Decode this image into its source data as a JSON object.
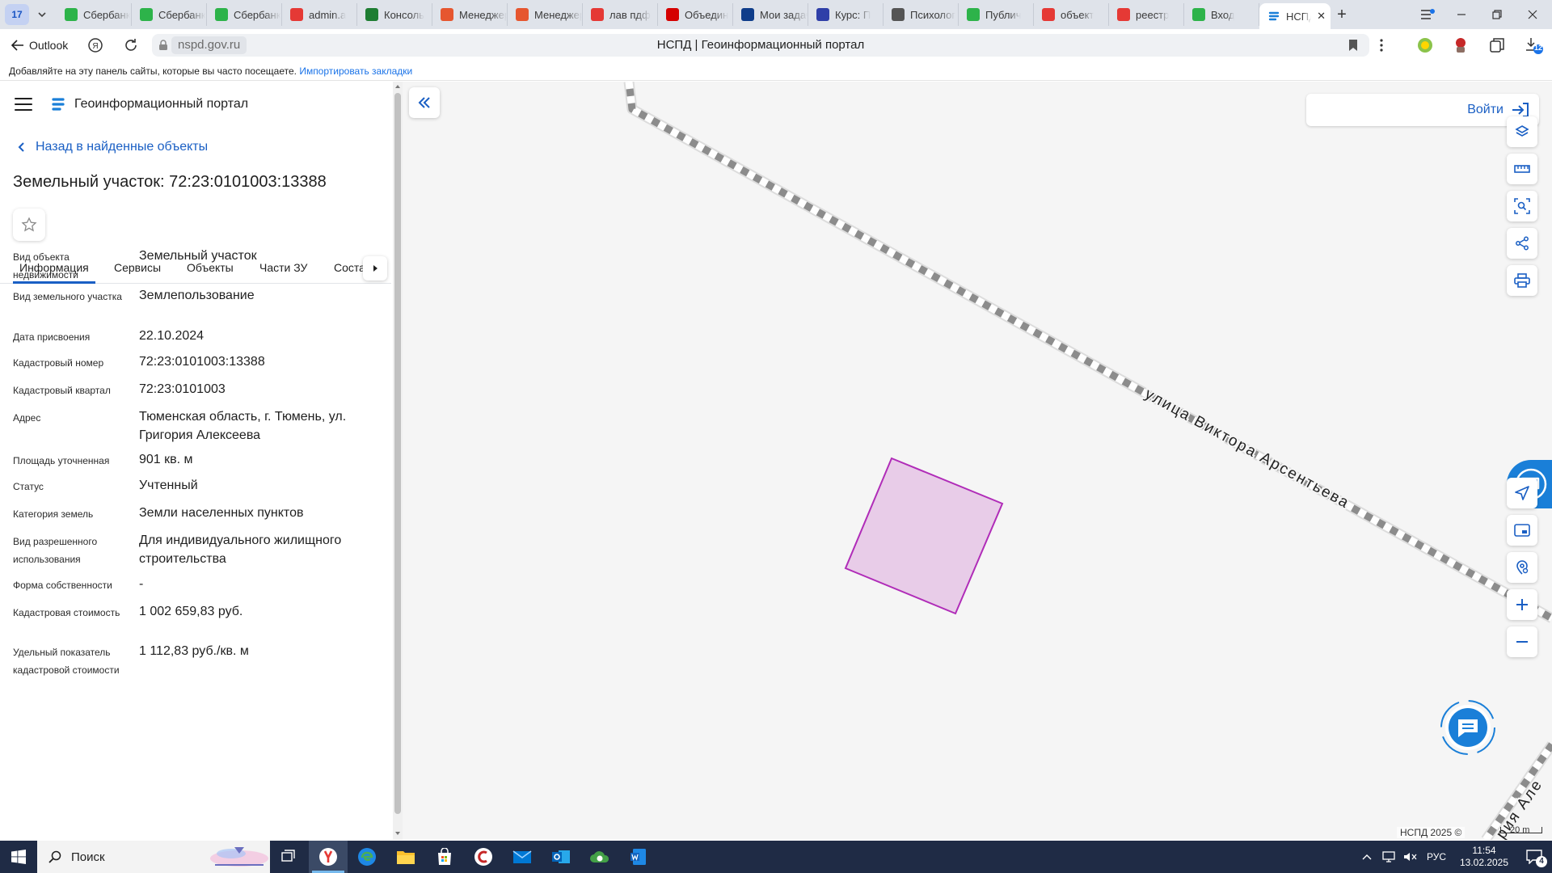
{
  "browser": {
    "tab_count": "17",
    "tabs": [
      {
        "title": "Сбербанк",
        "icon": "check-circle-icon",
        "color": "#2db34a"
      },
      {
        "title": "Сбербанк",
        "icon": "check-circle-icon",
        "color": "#2db34a"
      },
      {
        "title": "Сбербанк",
        "icon": "check-circle-icon",
        "color": "#2db34a"
      },
      {
        "title": "admin.a",
        "icon": "yandex-icon",
        "color": "#e53935"
      },
      {
        "title": "Консоль",
        "icon": "flag-icon",
        "color": "#1e7d32"
      },
      {
        "title": "Менеджер",
        "icon": "joomla-icon",
        "color": "#e6562f"
      },
      {
        "title": "Менеджер",
        "icon": "joomla-icon",
        "color": "#e6562f"
      },
      {
        "title": "лав пдф",
        "icon": "yandex-icon",
        "color": "#e53935"
      },
      {
        "title": "Объедин",
        "icon": "gift-icon",
        "color": "#d50000"
      },
      {
        "title": "Мои задачи",
        "icon": "24-icon",
        "color": "#0f3d8a"
      },
      {
        "title": "Курс: П",
        "icon": "bookmark-icon",
        "color": "#2f3fa8"
      },
      {
        "title": "Психолог",
        "icon": "page-icon",
        "color": "#555555"
      },
      {
        "title": "Публич",
        "icon": "check-circle-icon",
        "color": "#2db34a"
      },
      {
        "title": "объект",
        "icon": "yandex-icon",
        "color": "#e53935"
      },
      {
        "title": "реестр",
        "icon": "yandex-icon",
        "color": "#e53935"
      },
      {
        "title": "Вход",
        "icon": "plus-green-icon",
        "color": "#2db34a"
      }
    ],
    "active_tab": {
      "title": "НСПД",
      "icon": "nspd-icon"
    },
    "back_label": "Outlook",
    "url": "nspd.gov.ru",
    "page_title": "НСПД | Геоинформационный портал",
    "downloads_badge": "12",
    "bookmarks_hint": "Добавляйте на эту панель сайты, которые вы часто посещаете.",
    "bookmarks_link": "Импортировать закладки"
  },
  "panel": {
    "app_title": "Геоинформационный портал",
    "back_link": "Назад в найденные объекты",
    "object_title": "Земельный участок: 72:23:0101003:13388",
    "tabs": [
      "Информация",
      "Сервисы",
      "Объекты",
      "Части ЗУ",
      "Состав"
    ],
    "fields": [
      {
        "label": "Вид объекта недвижимости",
        "value": "Земельный участок"
      },
      {
        "label": "Вид земельного участка",
        "value": "Землепользование"
      },
      {
        "label": "Дата присвоения",
        "value": "22.10.2024"
      },
      {
        "label": "Кадастровый номер",
        "value": "72:23:0101003:13388"
      },
      {
        "label": "Кадастровый квартал",
        "value": "72:23:0101003"
      },
      {
        "label": "Адрес",
        "value": "Тюменская область, г. Тюмень, ул. Григория Алексеева"
      },
      {
        "label": "Площадь уточненная",
        "value": "901 кв. м"
      },
      {
        "label": "Статус",
        "value": "Учтенный"
      },
      {
        "label": "Категория земель",
        "value": "Земли населенных пунктов"
      },
      {
        "label": "Вид разрешенного использования",
        "value": "Для индивидуального жилищного строительства"
      },
      {
        "label": "Форма собственности",
        "value": "-"
      },
      {
        "label": "Кадастровая стоимость",
        "value": "1 002 659,83 руб."
      },
      {
        "label": "Удельный показатель кадастровой стоимости",
        "value": "1 112,83 руб./кв. м"
      }
    ]
  },
  "map": {
    "login_label": "Войти",
    "street_name": "улица Виктора Арсентьева",
    "street_name_2": "рия Але",
    "copyright": "НСПД 2025 ©",
    "scale": "20 m",
    "parcel_fill": "#e8cce8",
    "parcel_stroke": "#b02cb8"
  },
  "taskbar": {
    "search_placeholder": "Поиск",
    "language": "РУС",
    "time": "11:54",
    "date": "13.02.2025",
    "notifications": "4"
  }
}
